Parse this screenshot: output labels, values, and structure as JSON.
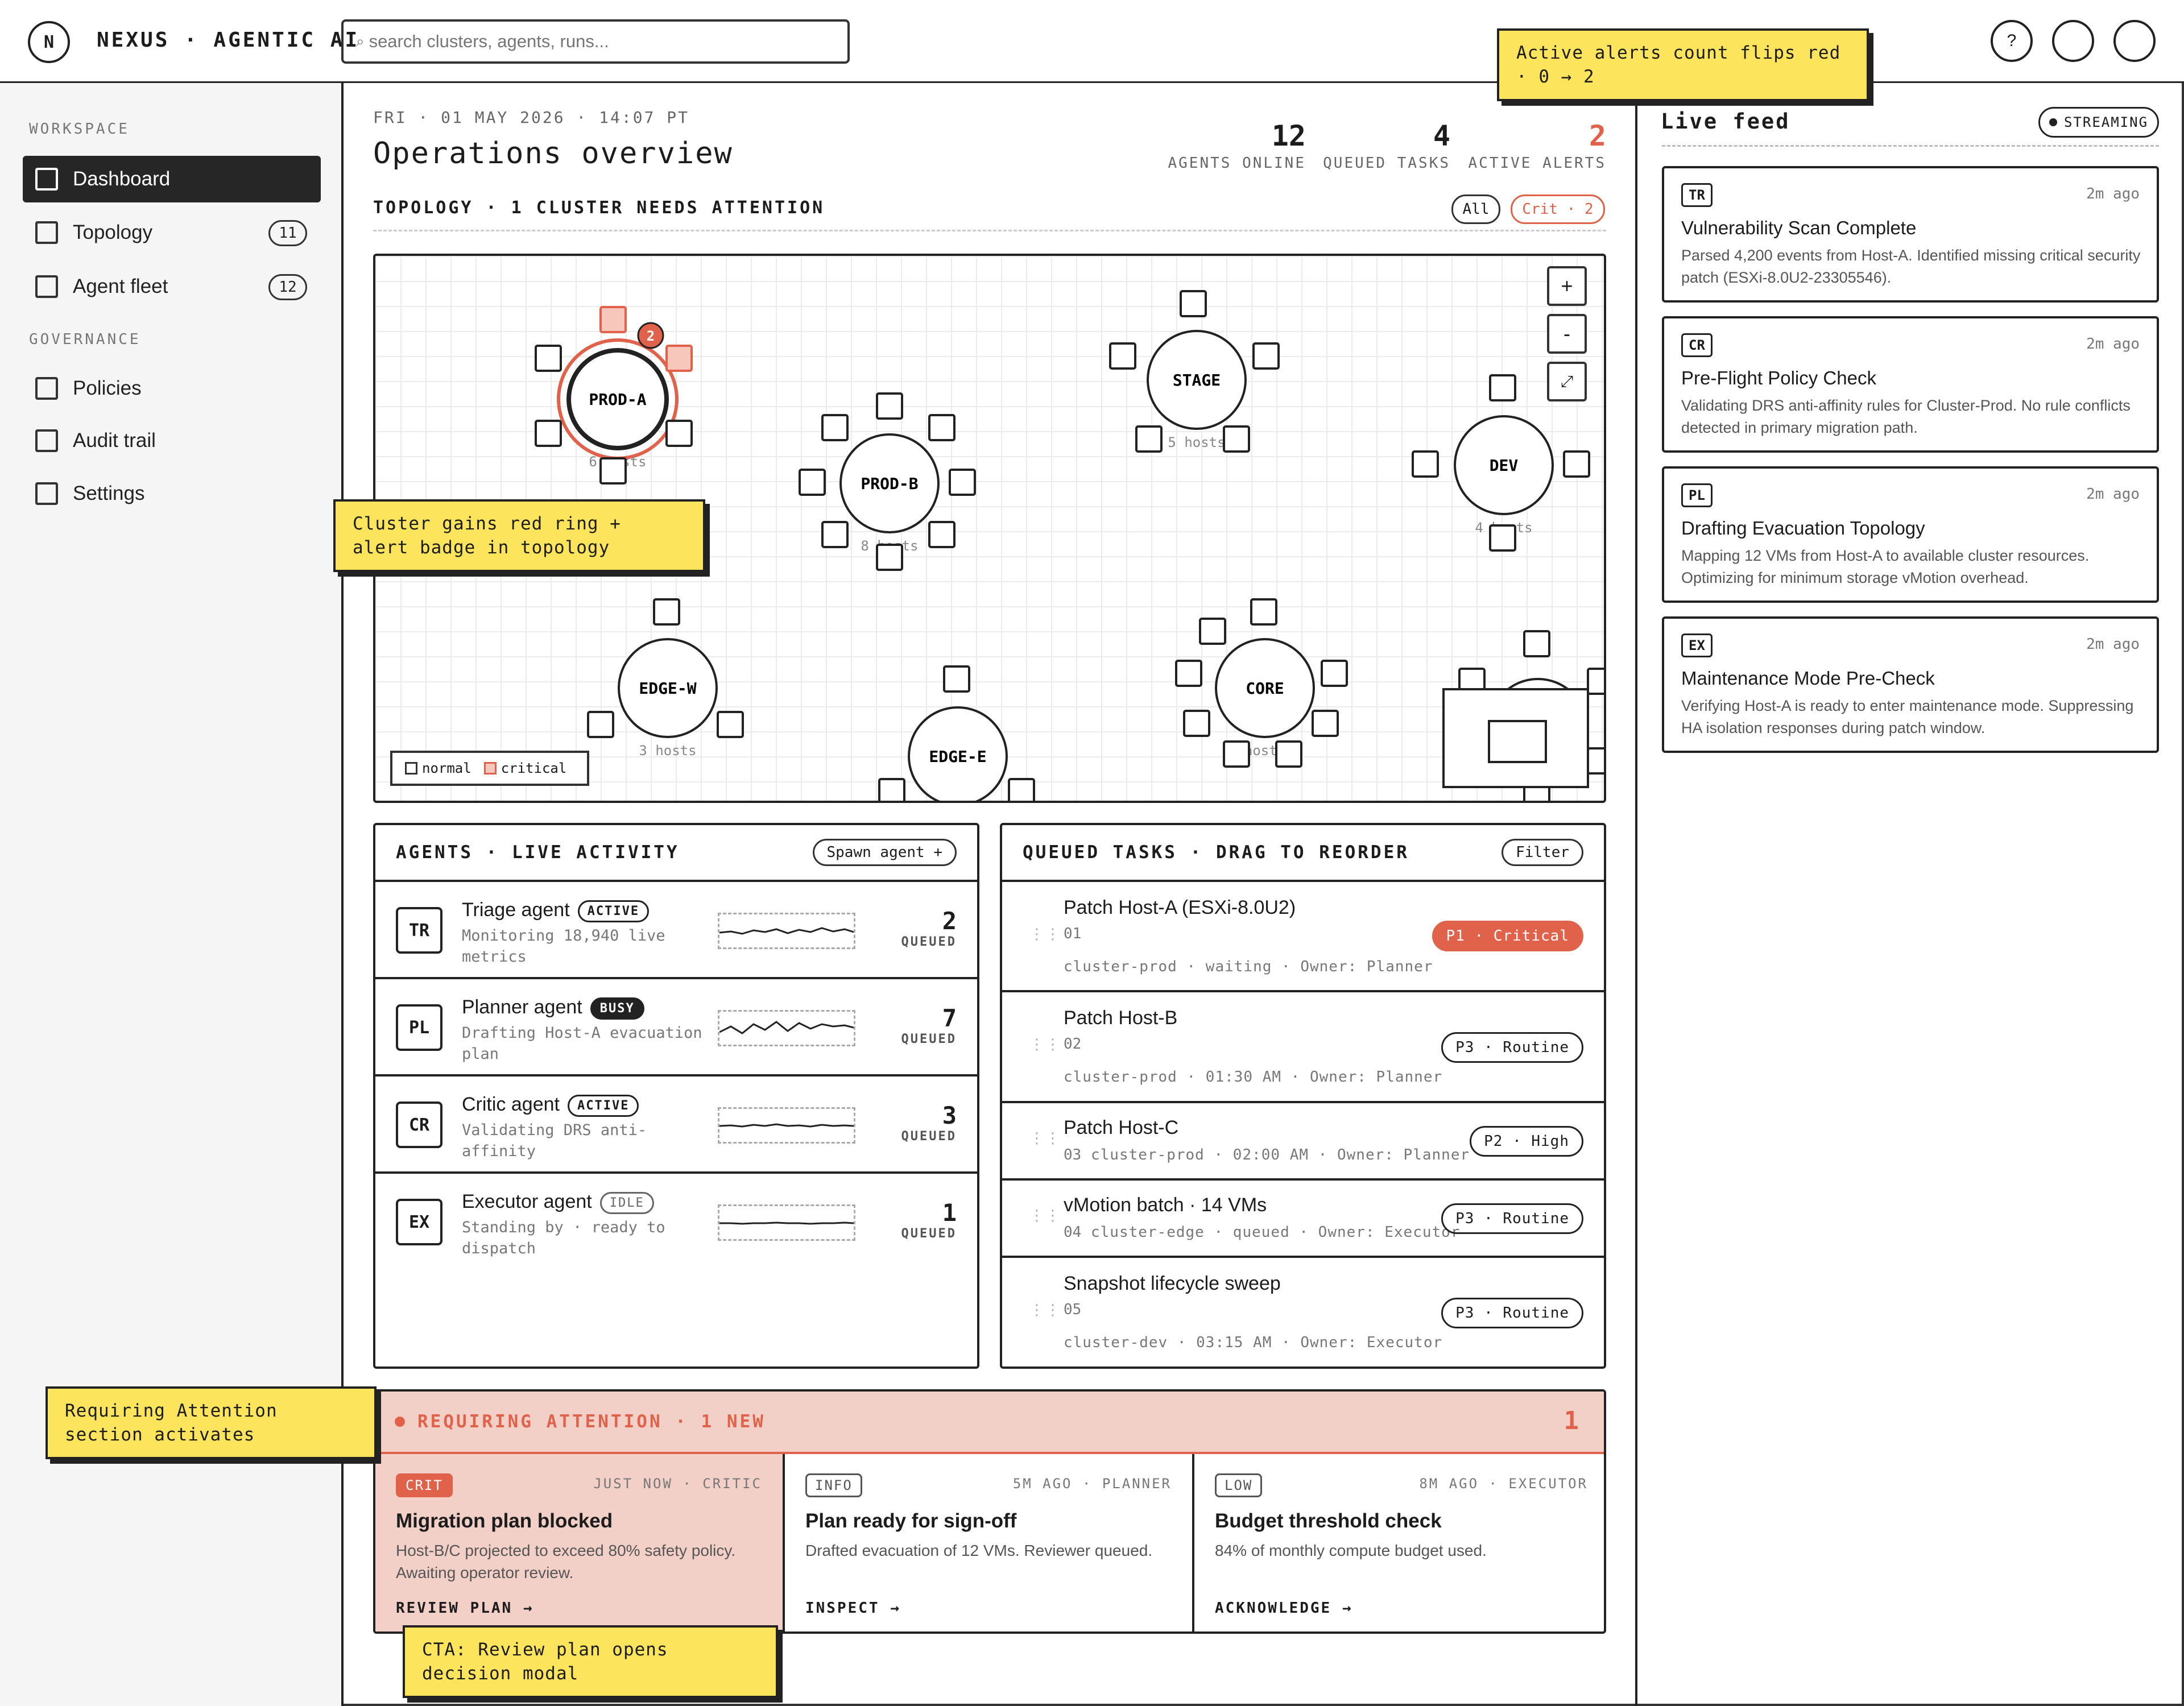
{
  "header": {
    "logo_letter": "N",
    "brand": "NEXUS · AGENTIC AI",
    "search_placeholder": "search clusters, agents, runs...",
    "help_label": "?"
  },
  "sidebar": {
    "workspace_label": "WORKSPACE",
    "governance_label": "GOVERNANCE",
    "items": [
      {
        "label": "Dashboard",
        "count": ""
      },
      {
        "label": "Topology",
        "count": "11"
      },
      {
        "label": "Agent fleet",
        "count": "12"
      },
      {
        "label": "Policies",
        "count": ""
      },
      {
        "label": "Audit trail",
        "count": ""
      },
      {
        "label": "Settings",
        "count": ""
      }
    ]
  },
  "overview": {
    "date": "FRI · 01 MAY 2026 · 14:07 PT",
    "title": "Operations overview",
    "stats": [
      {
        "value": "12",
        "label": "AGENTS ONLINE"
      },
      {
        "value": "4",
        "label": "QUEUED TASKS"
      },
      {
        "value": "2",
        "label": "ACTIVE ALERTS"
      }
    ]
  },
  "topology": {
    "title": "TOPOLOGY · 1 CLUSTER NEEDS ATTENTION",
    "filter_all": "All",
    "filter_crit": "Crit · 2",
    "clusters": [
      {
        "name": "PROD-A",
        "hosts": "6 hosts",
        "critical": true,
        "badge": "2"
      },
      {
        "name": "PROD-B",
        "hosts": "8 hosts",
        "critical": false
      },
      {
        "name": "STAGE",
        "hosts": "5 hosts",
        "critical": false
      },
      {
        "name": "DEV",
        "hosts": "4 hosts",
        "critical": false
      },
      {
        "name": "EDGE-W",
        "hosts": "3 hosts",
        "critical": false
      },
      {
        "name": "EDGE-E",
        "hosts": "",
        "critical": false
      },
      {
        "name": "CORE",
        "hosts": "hosts",
        "critical": false
      }
    ],
    "zoom_in": "+",
    "zoom_out": "-",
    "fit": "⤢",
    "legend_normal": "normal",
    "legend_critical": "critical"
  },
  "agents": {
    "title": "AGENTS · LIVE ACTIVITY",
    "spawn_label": "Spawn agent +",
    "queued_label": "QUEUED",
    "rows": [
      {
        "initials": "TR",
        "name": "Triage agent",
        "status": "ACTIVE",
        "desc": "Monitoring 18,940 live metrics",
        "queued": "2"
      },
      {
        "initials": "PL",
        "name": "Planner agent",
        "status": "BUSY",
        "desc": "Drafting Host-A evacuation plan",
        "queued": "7"
      },
      {
        "initials": "CR",
        "name": "Critic agent",
        "status": "ACTIVE",
        "desc": "Validating DRS anti-affinity",
        "queued": "3"
      },
      {
        "initials": "EX",
        "name": "Executor agent",
        "status": "IDLE",
        "desc": "Standing by · ready to dispatch",
        "queued": "1"
      }
    ]
  },
  "tasks": {
    "title": "QUEUED TASKS · DRAG TO REORDER",
    "filter_label": "Filter",
    "rows": [
      {
        "title": "Patch Host-A (ESXi-8.0U2)",
        "num": "01",
        "meta": "cluster-prod · waiting · Owner: Planner",
        "priority": "P1 · Critical"
      },
      {
        "title": "Patch Host-B",
        "num": "02",
        "meta": "cluster-prod · 01:30 AM · Owner: Planner",
        "priority": "P3 · Routine"
      },
      {
        "title": "Patch Host-C",
        "num": "03",
        "meta": "cluster-prod · 02:00 AM · Owner: Planner",
        "priority": "P2 · High"
      },
      {
        "title": "vMotion batch · 14 VMs",
        "num": "04",
        "meta": "cluster-edge · queued · Owner: Executor",
        "priority": "P3 · Routine"
      },
      {
        "title": "Snapshot lifecycle sweep",
        "num": "05",
        "meta": "cluster-dev · 03:15 AM · Owner: Executor",
        "priority": "P3 · Routine"
      }
    ]
  },
  "attention": {
    "title": "REQUIRING ATTENTION · 1 NEW",
    "count": "1",
    "cards": [
      {
        "tag": "CRIT",
        "time": "JUST NOW · CRITIC",
        "title": "Migration plan blocked",
        "desc": "Host-B/C projected to exceed 80% safety policy. Awaiting operator review.",
        "cta": "REVIEW PLAN →"
      },
      {
        "tag": "INFO",
        "time": "5M AGO · PLANNER",
        "title": "Plan ready for sign-off",
        "desc": "Drafted evacuation of 12 VMs. Reviewer queued.",
        "cta": "INSPECT →"
      },
      {
        "tag": "LOW",
        "time": "8M AGO · EXECUTOR",
        "title": "Budget threshold check",
        "desc": "84% of monthly compute budget used.",
        "cta": "ACKNOWLEDGE →"
      }
    ]
  },
  "feed": {
    "title": "Live feed",
    "streaming": "STREAMING",
    "items": [
      {
        "tag": "TR",
        "time": "2m ago",
        "title": "Vulnerability Scan Complete",
        "desc": "Parsed 4,200 events from Host-A. Identified missing critical security patch (ESXi-8.0U2-23305546)."
      },
      {
        "tag": "CR",
        "time": "2m ago",
        "title": "Pre-Flight Policy Check",
        "desc": "Validating DRS anti-affinity rules for Cluster-Prod. No rule conflicts detected in primary migration path."
      },
      {
        "tag": "PL",
        "time": "2m ago",
        "title": "Drafting Evacuation Topology",
        "desc": "Mapping 12 VMs from Host-A to available cluster resources. Optimizing for minimum storage vMotion overhead."
      },
      {
        "tag": "EX",
        "time": "2m ago",
        "title": "Maintenance Mode Pre-Check",
        "desc": "Verifying Host-A is ready to enter maintenance mode. Suppressing HA isolation responses during patch window."
      }
    ]
  },
  "annotations": {
    "alerts": "Active alerts count flips red · 0 → 2",
    "cluster": "Cluster gains red ring + alert badge in topology",
    "attention": "Requiring Attention section activates",
    "cta": "CTA: Review plan opens decision modal"
  },
  "colors": {
    "accent": "#e0624a",
    "critical_fill": "#f3d0c7",
    "note": "#fde45d",
    "ink": "#222222"
  }
}
